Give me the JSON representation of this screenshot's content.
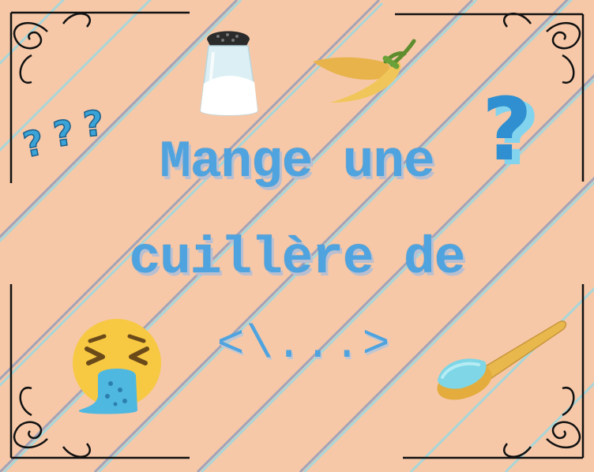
{
  "title": {
    "line1": "Mange une",
    "line2": "cuillère de",
    "placeholder": "<\\...>"
  },
  "icons": [
    "salt-shaker-icon",
    "chili-pepper-icon",
    "question-marks-icon",
    "question-mark-icon",
    "vomiting-face-icon",
    "spoon-icon",
    "ornate-corner-icon"
  ],
  "colors": {
    "background": "#f6c8a8",
    "stripe_blue": "#a9d6d8",
    "stripe_gray": "#a3a3b8",
    "text": "#4fa3de",
    "text_shadow": "#b9bfd0",
    "frame": "#111111"
  }
}
